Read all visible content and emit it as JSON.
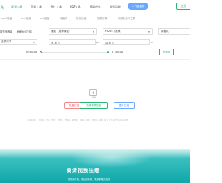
{
  "header": {
    "logo_char": "鸟",
    "nav": [
      "视频工具",
      "音频工具",
      "图片工具",
      "PDF工具",
      "帮助中心",
      "常见功能"
    ],
    "vip_label": "开通会员",
    "login_label": "注册"
  },
  "tabs": [
    "mp4压缩",
    "mov压缩",
    "avi压缩",
    "转格式",
    "批量压缩",
    "视频剪辑",
    "视频去水印工具"
  ],
  "settings": {
    "compress_mode": "按压缩等级",
    "mode_option": "画面大小压缩",
    "quality_label": "画质（推荐最佳）",
    "codec_label": "H.264（推荐）",
    "format_label": "原格式",
    "resolution_label": "选择尺寸",
    "width_label": "宽 格 式",
    "width_unit": "px",
    "height_label": "高 格 式",
    "height_unit": "px",
    "start_time": "00:00:00",
    "end_time": "01:00:00",
    "preview_label": "开始预"
  },
  "upload": {
    "btn_delete": "批量压缩",
    "btn_select": "选择视频压缩",
    "btn_image": "图片压缩",
    "formats_text": "支持格式：mp4、flv、m4v、mov、mp3、wmv、3gp、flac、mkv、ogg 单个文件最大支持500M"
  },
  "banner": {
    "title": "高清视频压缩",
    "subtitle": "更好的体验，更快的转换，更多的格式支持"
  },
  "colors": {
    "accent": "#2bb673",
    "vip": "#6aa8ff",
    "danger": "#e45a5a",
    "banner": "#0fa7a8"
  }
}
